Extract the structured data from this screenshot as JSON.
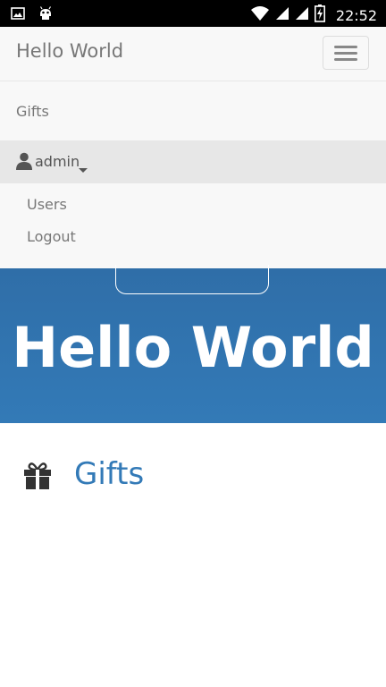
{
  "status_bar": {
    "time": "22:52",
    "icons": [
      "image-icon",
      "android-icon",
      "wifi-icon",
      "signal-icon",
      "signal-icon",
      "battery-charging-icon"
    ]
  },
  "navbar": {
    "brand": "Hello World",
    "toggle_icon": "hamburger-icon"
  },
  "menu": {
    "items": [
      {
        "label": "Gifts"
      }
    ],
    "dropdown": {
      "label": "admin",
      "icon": "user-icon",
      "items": [
        {
          "label": "Users"
        },
        {
          "label": "Logout"
        }
      ]
    }
  },
  "jumbotron": {
    "title": "Hello World"
  },
  "main": {
    "gifts_link": "Gifts",
    "gifts_icon": "gift-icon"
  },
  "colors": {
    "brand_blue": "#337ab7",
    "navbar_bg": "#f8f8f8",
    "active_row_bg": "#e7e7e7"
  }
}
